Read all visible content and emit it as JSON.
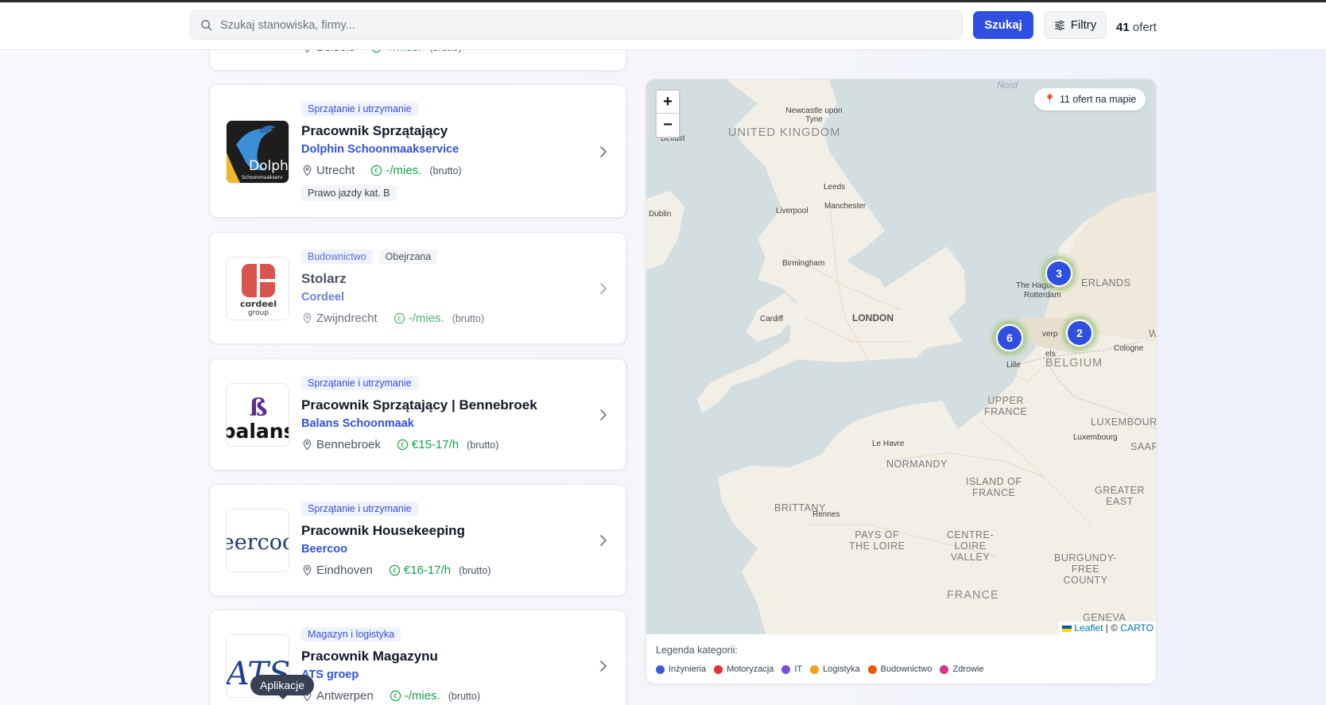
{
  "header": {
    "search_placeholder": "Szukaj stanowiska, firmy...",
    "search_button": "Szukaj",
    "filter_button": "Filtry",
    "offer_count": "41",
    "offer_count_suffix": "ofert"
  },
  "partial_card": {
    "location": "Belseis",
    "salary": "-/mies.",
    "brutto": "(brutto)"
  },
  "jobs": [
    {
      "category": "Sprzątanie i utrzymanie",
      "title": "Pracownik Sprzątający",
      "company": "Dolphin Schoonmaakservice",
      "location": "Utrecht",
      "salary": "-/mies.",
      "brutto": "(brutto)",
      "extra": "Prawo jazdy kat. B",
      "logo_text": "Dolph",
      "logo_sub": "Schoonmaakserv"
    },
    {
      "category": "Budownictwo",
      "seen": "Obejrzana",
      "title": "Stolarz",
      "company": "Cordeel",
      "location": "Zwijndrecht",
      "salary": "-/mies.",
      "brutto": "(brutto)",
      "logo_text": "cordeel",
      "logo_sub": "group"
    },
    {
      "category": "Sprzątanie i utrzymanie",
      "title": "Pracownik Sprzątający | Bennebroek",
      "company": "Balans Schoonmaak",
      "location": "Bennebroek",
      "salary": "€15-17/h",
      "brutto": "(brutto)",
      "logo_text": "balans"
    },
    {
      "category": "Sprzątanie i utrzymanie",
      "title": "Pracownik Housekeeping",
      "company": "Beercoo",
      "location": "Eindhoven",
      "salary": "€16-17/h",
      "brutto": "(brutto)",
      "logo_text": "eercoo"
    },
    {
      "category": "Magazyn i logistyka",
      "title": "Pracownik Magazynu",
      "company": "ATS groep",
      "location": "Antwerpen",
      "salary": "-/mies.",
      "brutto": "(brutto)",
      "logo_text": "ATS"
    }
  ],
  "map": {
    "badge": "11 ofert na mapie",
    "zoom_in": "+",
    "zoom_out": "−",
    "clusters": [
      "3",
      "6",
      "2"
    ],
    "places": {
      "nord": "Nord",
      "newcastle": "Newcastle upon Tyne",
      "belfast": "Belfast",
      "uk": "UNITED KINGDOM",
      "leeds": "Leeds",
      "dublin": "Dublin",
      "liverpool": "Liverpool",
      "manchester": "Manchester",
      "birmingham": "Birmingham",
      "cardiff": "Cardiff",
      "london": "LONDON",
      "hague": "The Hague",
      "rotterdam": "Rotterdam",
      "nl": "ERLANDS",
      "antwerp": "verp",
      "brussels": "els",
      "lille": "Lille",
      "belgium": "BELGIUM",
      "cologne": "Cologne",
      "w": "W",
      "upper_france": "UPPER\nFRANCE",
      "luxembourg_r": "LUXEMBOUR",
      "luxembourg": "Luxembourg",
      "saar": "SAAR",
      "lehavre": "Le Havre",
      "normandy": "NORMANDY",
      "idf": "ISLAND OF\nFRANCE",
      "greater_east": "GREATER\nEAST",
      "brittany": "BRITTANY",
      "rennes": "Rennes",
      "pays_loire": "PAYS OF\nTHE LOIRE",
      "centre": "CENTRE-\nLOIRE\nVALLEY",
      "burgundy": "BURGUNDY-\nFREE\nCOUNTY",
      "france": "FRANCE",
      "geneva": "GENEVA"
    },
    "attribution_leaflet": "Leaflet",
    "attribution_sep": " | © ",
    "attribution_carto": "CARTO"
  },
  "legend": {
    "title": "Legenda kategorii:",
    "items": [
      {
        "label": "Inżynieria",
        "color": "#3b5bdb"
      },
      {
        "label": "Motoryzacja",
        "color": "#e03131"
      },
      {
        "label": "IT",
        "color": "#7c4ddb"
      },
      {
        "label": "Logistyka",
        "color": "#f0a020"
      },
      {
        "label": "Budownictwo",
        "color": "#e8590c"
      },
      {
        "label": "Zdrowie",
        "color": "#d6338c"
      }
    ]
  },
  "tooltip": "Aplikacje"
}
